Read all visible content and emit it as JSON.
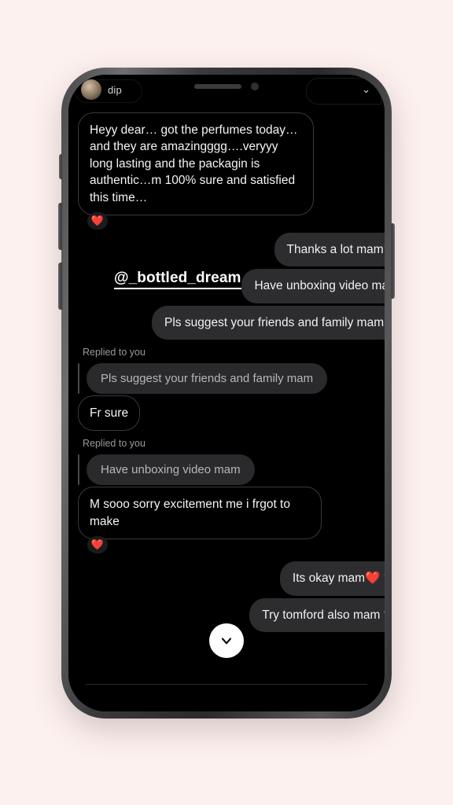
{
  "app": {
    "background_color": "#fdf1ef",
    "device": "smartphone-mockup"
  },
  "header": {
    "contact_name": "dip",
    "avatar_name": "contact-avatar",
    "chevron_icon": "⌄",
    "collapse_icon_name": "chevron-down-icon"
  },
  "overlay": {
    "username": "@_bottled_dream"
  },
  "thread": {
    "messages": [
      {
        "id": "m1",
        "direction": "incoming",
        "text": "Heyy dear… got the perfumes today… and they are amazingggg….veryyy long lasting and the packagin is authentic…m 100% sure and satisfied this time…",
        "reaction": "❤️",
        "wrapped": true
      },
      {
        "id": "m2",
        "direction": "outgoing",
        "text": "Thanks a lot mam❤️",
        "reaction": null,
        "wrapped": false
      },
      {
        "id": "m3",
        "direction": "outgoing",
        "text": "Have unboxing video mam",
        "reaction": null,
        "wrapped": false
      },
      {
        "id": "m4",
        "direction": "outgoing",
        "text": "Pls suggest your friends and family mam",
        "reaction": null,
        "wrapped": true
      }
    ],
    "reply_groups": [
      {
        "id": "r1",
        "label": "Replied to you",
        "quoted_text": "Pls suggest your friends and family mam",
        "response_text": "Fr sure",
        "response_reaction": null
      },
      {
        "id": "r2",
        "label": "Replied to you",
        "quoted_text": "Have unboxing video mam",
        "response_text": "M sooo sorry excitement me i frgot to make",
        "response_reaction": "❤️"
      }
    ],
    "tail_messages": [
      {
        "id": "m5",
        "direction": "outgoing",
        "text": "Its okay mam❤️ ❤️",
        "wrapped": false
      },
      {
        "id": "m6",
        "direction": "outgoing",
        "text": "Try tomford also mam 🤍",
        "wrapped": false
      }
    ]
  },
  "scroll_button": {
    "name": "scroll-to-bottom-button",
    "icon": "chevron-down-icon"
  }
}
